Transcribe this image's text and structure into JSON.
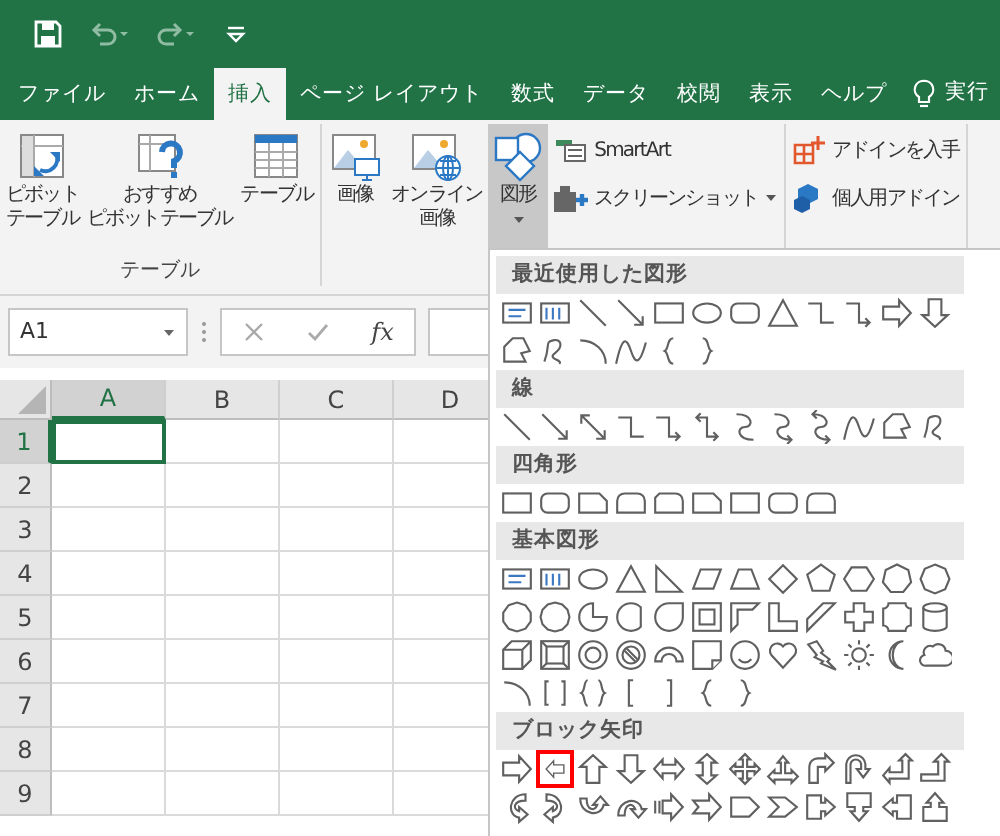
{
  "quick_access": [
    {
      "kind": "save",
      "disabled": false
    },
    {
      "kind": "undo",
      "disabled": true
    },
    {
      "kind": "redo",
      "disabled": true
    },
    {
      "kind": "customize",
      "disabled": false
    }
  ],
  "tabs": [
    {
      "label": "ファイル",
      "selected": false
    },
    {
      "label": "ホーム",
      "selected": false
    },
    {
      "label": "挿入",
      "selected": true
    },
    {
      "label": "ページ レイアウト",
      "selected": false
    },
    {
      "label": "数式",
      "selected": false
    },
    {
      "label": "データ",
      "selected": false
    },
    {
      "label": "校閲",
      "selected": false
    },
    {
      "label": "表示",
      "selected": false
    },
    {
      "label": "ヘルプ",
      "selected": false
    }
  ],
  "tell_me": {
    "text": "実行"
  },
  "ribbon": {
    "groups": [
      {
        "label": "テーブル",
        "commands": [
          {
            "kind": "large",
            "label": [
              "ピボット",
              "テーブル"
            ],
            "pressed": false,
            "dropdown": false
          },
          {
            "kind": "large",
            "label": [
              "おすすめ",
              "ピボットテーブル"
            ],
            "pressed": false,
            "dropdown": false
          },
          {
            "kind": "large",
            "label": [
              "テーブル"
            ],
            "pressed": false,
            "dropdown": false
          }
        ]
      },
      {
        "commands": [
          {
            "kind": "large",
            "label": [
              "画像"
            ],
            "pressed": false,
            "dropdown": false
          },
          {
            "kind": "large",
            "label": [
              "オンライン",
              "画像"
            ],
            "pressed": false,
            "dropdown": false
          },
          {
            "kind": "large",
            "label": [
              "図形"
            ],
            "pressed": true,
            "dropdown": true
          },
          {
            "kind": "small",
            "label": "SmartArt",
            "pressed": false,
            "dropdown": false
          },
          {
            "kind": "small",
            "label": "スクリーンショット",
            "pressed": false,
            "dropdown": true
          }
        ]
      },
      {
        "commands": [
          {
            "kind": "small",
            "label": "アドインを入手",
            "pressed": false,
            "dropdown": false
          },
          {
            "kind": "small",
            "label": "個人用アドイン",
            "pressed": false,
            "dropdown": false
          }
        ]
      }
    ]
  },
  "formula_bar": {
    "name_box": "A1",
    "function_button": "fx"
  },
  "sheet": {
    "columns": [
      {
        "label": "A",
        "selected": true
      },
      {
        "label": "B",
        "selected": false
      },
      {
        "label": "C",
        "selected": false
      },
      {
        "label": "D",
        "selected": false
      }
    ],
    "rows": [
      {
        "label": "1",
        "selected": true
      },
      {
        "label": "2",
        "selected": false
      },
      {
        "label": "3",
        "selected": false
      },
      {
        "label": "4",
        "selected": false
      },
      {
        "label": "5",
        "selected": false
      },
      {
        "label": "6",
        "selected": false
      },
      {
        "label": "7",
        "selected": false
      },
      {
        "label": "8",
        "selected": false
      },
      {
        "label": "9",
        "selected": false
      }
    ]
  },
  "shapes_menu": {
    "sections": [
      {
        "heading": "最近使用した図形",
        "shapes": [
          {
            "kind": "textbox",
            "highlighted": false
          },
          {
            "kind": "vertical-textbox",
            "highlighted": false
          },
          {
            "kind": "line",
            "highlighted": false
          },
          {
            "kind": "arrow-line",
            "highlighted": false
          },
          {
            "kind": "rectangle",
            "highlighted": false
          },
          {
            "kind": "oval",
            "highlighted": false
          },
          {
            "kind": "rounded-rectangle",
            "highlighted": false
          },
          {
            "kind": "triangle",
            "highlighted": false
          },
          {
            "kind": "elbow",
            "highlighted": false
          },
          {
            "kind": "elbow-arrow",
            "highlighted": false
          },
          {
            "kind": "right-arrow",
            "highlighted": false
          },
          {
            "kind": "down-arrow",
            "highlighted": false
          },
          {
            "kind": "freeform",
            "highlighted": false
          },
          {
            "kind": "scribble",
            "highlighted": false
          },
          {
            "kind": "arc",
            "highlighted": false
          },
          {
            "kind": "curve",
            "highlighted": false
          },
          {
            "kind": "left-brace",
            "highlighted": false
          },
          {
            "kind": "right-brace",
            "highlighted": false
          }
        ]
      },
      {
        "heading": "線",
        "shapes": [
          {
            "kind": "line",
            "highlighted": false
          },
          {
            "kind": "arrow-line",
            "highlighted": false
          },
          {
            "kind": "double-arrow-line",
            "highlighted": false
          },
          {
            "kind": "elbow",
            "highlighted": false
          },
          {
            "kind": "elbow-arrow",
            "highlighted": false
          },
          {
            "kind": "elbow-double-arrow",
            "highlighted": false
          },
          {
            "kind": "curved-connector",
            "highlighted": false
          },
          {
            "kind": "curved-arrow-connector",
            "highlighted": false
          },
          {
            "kind": "curved-double-arrow-connector",
            "highlighted": false
          },
          {
            "kind": "curve",
            "highlighted": false
          },
          {
            "kind": "freeform",
            "highlighted": false
          },
          {
            "kind": "scribble",
            "highlighted": false
          }
        ]
      },
      {
        "heading": "四角形",
        "shapes": [
          {
            "kind": "rectangle",
            "highlighted": false
          },
          {
            "kind": "rounded-rectangle",
            "highlighted": false
          },
          {
            "kind": "snipped-rectangle",
            "highlighted": false
          },
          {
            "kind": "round-top-rectangle",
            "highlighted": false
          },
          {
            "kind": "snip-round-rectangle",
            "highlighted": false
          },
          {
            "kind": "snipped-rectangle",
            "highlighted": false
          },
          {
            "kind": "rectangle",
            "highlighted": false
          },
          {
            "kind": "rounded-rectangle",
            "highlighted": false
          },
          {
            "kind": "round-top-rectangle",
            "highlighted": false
          }
        ]
      },
      {
        "heading": "基本図形",
        "shapes": [
          {
            "kind": "textbox",
            "highlighted": false
          },
          {
            "kind": "vertical-textbox",
            "highlighted": false
          },
          {
            "kind": "oval",
            "highlighted": false
          },
          {
            "kind": "triangle",
            "highlighted": false
          },
          {
            "kind": "right-triangle",
            "highlighted": false
          },
          {
            "kind": "parallelogram",
            "highlighted": false
          },
          {
            "kind": "trapezoid",
            "highlighted": false
          },
          {
            "kind": "diamond",
            "highlighted": false
          },
          {
            "kind": "pentagon",
            "highlighted": false
          },
          {
            "kind": "hexagon",
            "highlighted": false
          },
          {
            "kind": "heptagon",
            "highlighted": false
          },
          {
            "kind": "octagon",
            "highlighted": false
          },
          {
            "kind": "decagon",
            "highlighted": false
          },
          {
            "kind": "dodecagon",
            "highlighted": false
          },
          {
            "kind": "pie",
            "highlighted": false
          },
          {
            "kind": "chord",
            "highlighted": false
          },
          {
            "kind": "teardrop",
            "highlighted": false
          },
          {
            "kind": "frame",
            "highlighted": false
          },
          {
            "kind": "half-frame",
            "highlighted": false
          },
          {
            "kind": "l-shape",
            "highlighted": false
          },
          {
            "kind": "diagonal-stripe",
            "highlighted": false
          },
          {
            "kind": "cross",
            "highlighted": false
          },
          {
            "kind": "plaque",
            "highlighted": false
          },
          {
            "kind": "can",
            "highlighted": false
          },
          {
            "kind": "cube",
            "highlighted": false
          },
          {
            "kind": "bevel",
            "highlighted": false
          },
          {
            "kind": "donut",
            "highlighted": false
          },
          {
            "kind": "no-symbol",
            "highlighted": false
          },
          {
            "kind": "block-arc",
            "highlighted": false
          },
          {
            "kind": "folded-corner",
            "highlighted": false
          },
          {
            "kind": "smiley",
            "highlighted": false
          },
          {
            "kind": "heart",
            "highlighted": false
          },
          {
            "kind": "lightning",
            "highlighted": false
          },
          {
            "kind": "sun",
            "highlighted": false
          },
          {
            "kind": "moon",
            "highlighted": false
          },
          {
            "kind": "cloud",
            "highlighted": false
          },
          {
            "kind": "arc",
            "highlighted": false
          },
          {
            "kind": "double-bracket",
            "highlighted": false
          },
          {
            "kind": "double-brace",
            "highlighted": false
          },
          {
            "kind": "left-bracket",
            "highlighted": false
          },
          {
            "kind": "right-bracket",
            "highlighted": false
          },
          {
            "kind": "left-brace",
            "highlighted": false
          },
          {
            "kind": "right-brace",
            "highlighted": false
          }
        ]
      },
      {
        "heading": "ブロック矢印",
        "shapes": [
          {
            "kind": "right-arrow",
            "highlighted": false
          },
          {
            "kind": "left-arrow",
            "highlighted": true
          },
          {
            "kind": "up-arrow",
            "highlighted": false
          },
          {
            "kind": "down-arrow",
            "highlighted": false
          },
          {
            "kind": "left-right-arrow",
            "highlighted": false
          },
          {
            "kind": "up-down-arrow",
            "highlighted": false
          },
          {
            "kind": "quad-arrow",
            "highlighted": false
          },
          {
            "kind": "left-right-up-arrow",
            "highlighted": false
          },
          {
            "kind": "bent-arrow",
            "highlighted": false
          },
          {
            "kind": "u-turn-arrow",
            "highlighted": false
          },
          {
            "kind": "left-up-arrow",
            "highlighted": false
          },
          {
            "kind": "bent-up-arrow",
            "highlighted": false
          },
          {
            "kind": "curved-right-arrow",
            "highlighted": false
          },
          {
            "kind": "curved-left-arrow",
            "highlighted": false
          },
          {
            "kind": "curved-up-arrow",
            "highlighted": false
          },
          {
            "kind": "curved-down-arrow",
            "highlighted": false
          },
          {
            "kind": "striped-right-arrow",
            "highlighted": false
          },
          {
            "kind": "notched-right-arrow",
            "highlighted": false
          },
          {
            "kind": "pentagon-arrow",
            "highlighted": false
          },
          {
            "kind": "chevron",
            "highlighted": false
          },
          {
            "kind": "right-arrow-callout",
            "highlighted": false
          },
          {
            "kind": "down-arrow-callout",
            "highlighted": false
          },
          {
            "kind": "left-arrow-callout",
            "highlighted": false
          },
          {
            "kind": "up-arrow-callout",
            "highlighted": false
          }
        ]
      }
    ]
  }
}
